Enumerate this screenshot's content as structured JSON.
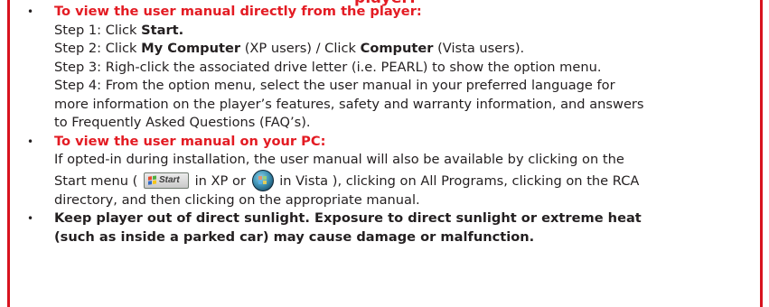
{
  "top_title_cut": "player:",
  "items": [
    {
      "heading": "To view the user manual directly from the player:",
      "steps": [
        {
          "prefix": "Step 1: Click ",
          "bold": "Start."
        },
        {
          "a": "Step 2: Click ",
          "b1": "My Computer",
          "c": " (XP users) / Click ",
          "b2": "Computer",
          "d": " (Vista users)."
        },
        {
          "text": "Step 3: Righ-click the associated drive letter (i.e. PEARL) to show the option menu."
        },
        {
          "lines": [
            "Step 4: From the option menu, select the user manual in your preferred language for",
            "more information on the player’s features, safety and warranty information, and answers",
            "to Frequently Asked Questions (FAQ’s)."
          ]
        }
      ]
    },
    {
      "heading": "To view the user manual on your PC:",
      "line1": "If opted-in during installation, the user manual will also be available by clicking on the",
      "line2_a": "Start menu ( ",
      "start_icon_label": "Start",
      "line2_b": " in XP or ",
      "line2_c": " in Vista ), clicking on All Programs, clicking on the RCA",
      "line3": "directory, and then clicking on the appropriate manual."
    },
    {
      "heading_line1": "Keep player out of direct sunlight. Exposure to direct sunlight or extreme heat",
      "heading_line2": "(such as inside a parked car) may cause damage or malfunction."
    }
  ],
  "bullet_glyph": "•",
  "colors": {
    "accent_red": "#e31b23",
    "border_red": "#d8121e",
    "text": "#231f20"
  },
  "icons": [
    "windows-xp-start-button-icon",
    "windows-vista-start-orb-icon"
  ]
}
